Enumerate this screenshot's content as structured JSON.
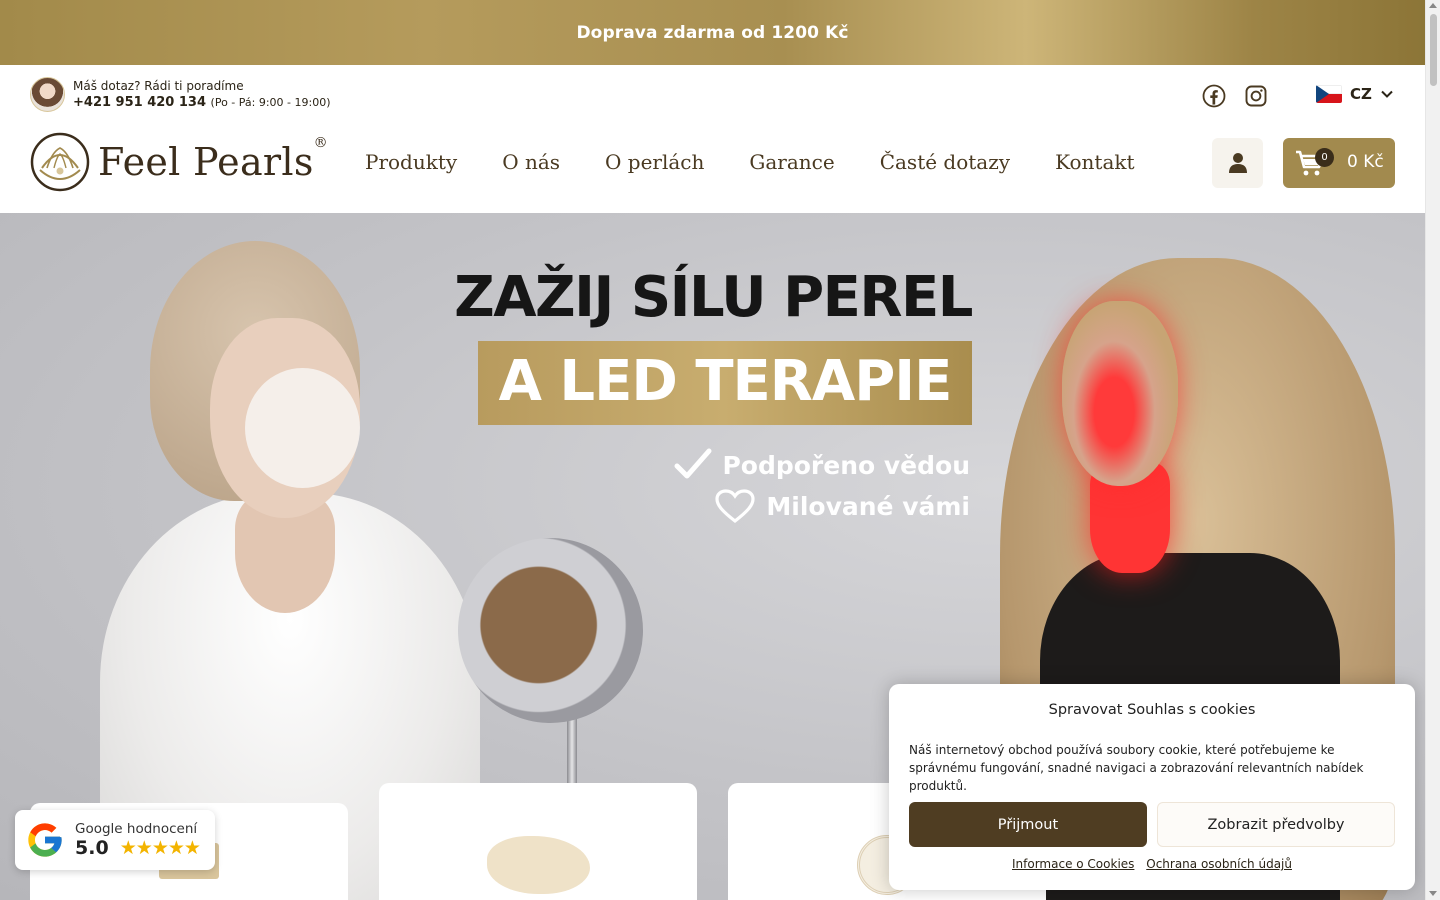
{
  "promo": {
    "text": "Doprava zdarma od 1200 Kč"
  },
  "contact": {
    "question": "Máš dotaz? Rádi ti poradíme",
    "phone": "+421 951 420 134",
    "hours": "(Po - Pá: 9:00 - 19:00)"
  },
  "language": {
    "code": "CZ"
  },
  "logo": {
    "text": "Feel Pearls",
    "mark": "®"
  },
  "nav": {
    "items": [
      "Produkty",
      "O nás",
      "O perlách",
      "Garance",
      "Časté dotazy",
      "Kontakt"
    ]
  },
  "cart": {
    "count": "0",
    "total": "0 Kč"
  },
  "hero": {
    "headline_line1": "ZAŽIJ SÍLU PEREL",
    "headline_line2": "A LED TERAPIE",
    "bullet1": "Podpořeno vědou",
    "bullet2": "Milované vámi"
  },
  "google_rating": {
    "label": "Google hodnocení",
    "score": "5.0",
    "stars": "★★★★★"
  },
  "cookie": {
    "title": "Spravovat Souhlas s cookies",
    "body": "Náš internetový obchod používá soubory cookie, které potřebujeme ke správnému fungování, snadné navigaci a zobrazování relevantních nabídek produktů.",
    "accept_label": "Přijmout",
    "prefs_label": "Zobrazit předvolby",
    "link_info": "Informace o Cookies",
    "link_privacy": "Ochrana osobních údajů"
  },
  "colors": {
    "gold": "#a28a4e",
    "dark_brown": "#4f3d22",
    "text": "#2b2417"
  }
}
